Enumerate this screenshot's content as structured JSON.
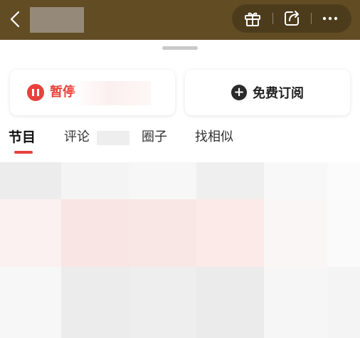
{
  "topbar": {
    "bg_color": "#614c24",
    "back_icon": "chevron-left-icon",
    "actions": [
      {
        "icon": "gift-icon"
      },
      {
        "icon": "share-icon"
      },
      {
        "icon": "more-icon"
      }
    ]
  },
  "cards": {
    "pause_label": "暂停",
    "subscribe_label": "免费订阅",
    "accent_color": "#e9413c"
  },
  "tabs": [
    {
      "label": "节目",
      "active": true
    },
    {
      "label": "评论",
      "active": false
    },
    {
      "label": "圈子",
      "active": false
    },
    {
      "label": "找相似",
      "active": false
    }
  ]
}
